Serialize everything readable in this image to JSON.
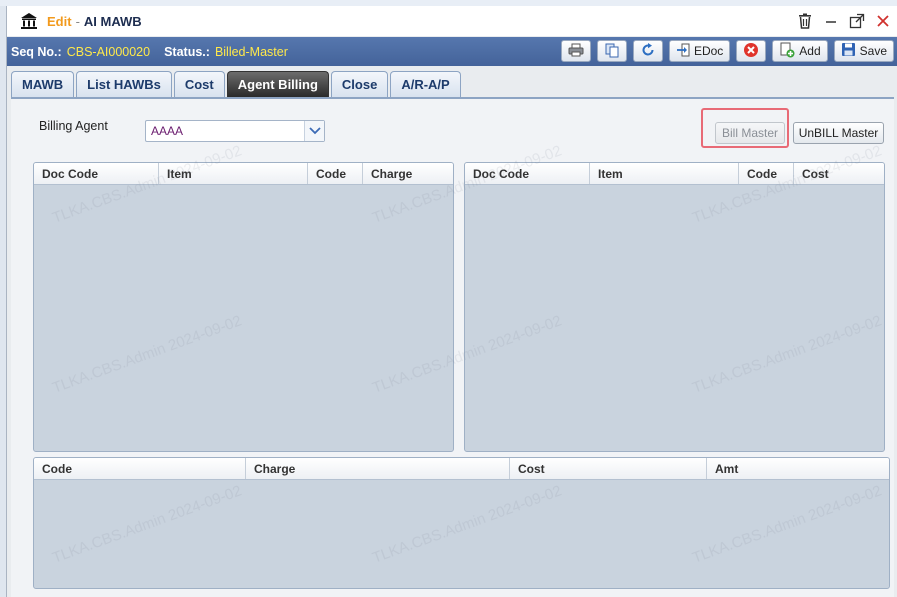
{
  "titlebar": {
    "edit_label": "Edit",
    "separator": "-",
    "title": "AI MAWB",
    "icon": "bank-icon",
    "controls": [
      "trash-icon",
      "minimize-icon",
      "maximize-icon",
      "close-icon"
    ]
  },
  "infobar": {
    "seq_label": "Seq No.:",
    "seq_value": "CBS-AI000020",
    "status_label": "Status.:",
    "status_value": "Billed-Master"
  },
  "toolbar": {
    "print_icon": "print-icon",
    "copy_icon": "copy-icon",
    "refresh_icon": "refresh-icon",
    "edoc_label": "EDoc",
    "delete_icon": "delete-icon",
    "add_label": "Add",
    "save_label": "Save"
  },
  "tabs": [
    {
      "label": "MAWB",
      "active": false
    },
    {
      "label": "List HAWBs",
      "active": false
    },
    {
      "label": "Cost",
      "active": false
    },
    {
      "label": "Agent Billing",
      "active": true
    },
    {
      "label": "Close",
      "active": false
    },
    {
      "label": "A/R-A/P",
      "active": false
    }
  ],
  "billing": {
    "agent_label": "Billing Agent",
    "agent_value": "AAAA",
    "bill_master_label": "Bill Master",
    "unbill_master_label": "UnBILL Master"
  },
  "grids": {
    "charge": {
      "headers": [
        "Doc Code",
        "Item",
        "Code",
        "Charge"
      ]
    },
    "cost": {
      "headers": [
        "Doc Code",
        "Item",
        "Code",
        "Cost"
      ]
    },
    "summary": {
      "headers": [
        "Code",
        "Charge",
        "Cost",
        "Amt"
      ]
    }
  },
  "watermark": "TLKA.CBS.Admin 2024-09-02",
  "colors": {
    "infobar": "#4b6aa3",
    "status_text": "#ffe94a",
    "edit_text": "#f29a1d",
    "grid_body": "#c9d3de",
    "highlight": "#e86a76"
  }
}
